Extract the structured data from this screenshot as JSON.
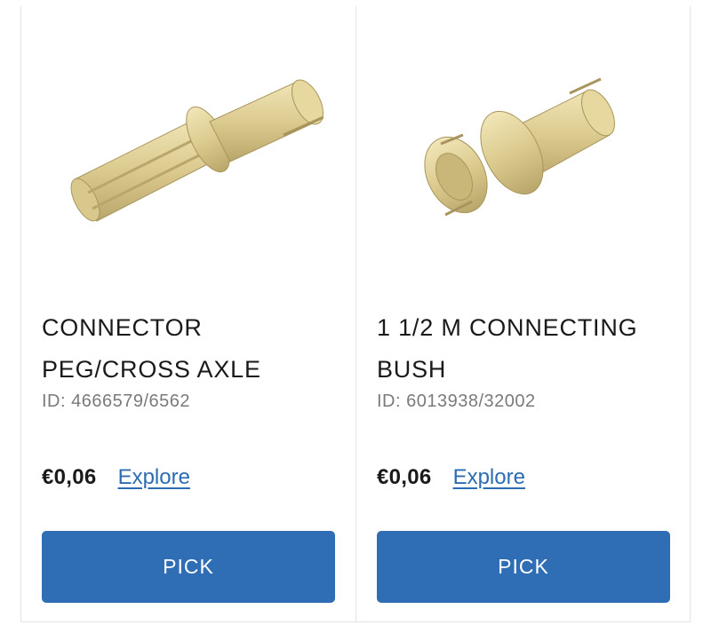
{
  "products": [
    {
      "title_line1": "CONNECTOR",
      "title_line2": "PEG/CROSS AXLE",
      "id_text": "ID: 4666579/6562",
      "price": "€0,06",
      "explore_label": "Explore",
      "pick_label": "PICK",
      "image": "connector-peg-cross-axle-image"
    },
    {
      "title_line1": "1 1/2 M CONNECTING",
      "title_line2": "BUSH",
      "id_text": "ID: 6013938/32002",
      "price": "€0,06",
      "explore_label": "Explore",
      "pick_label": "PICK",
      "image": "connecting-bush-image"
    }
  ],
  "colors": {
    "brick_tan": "#dccb8f",
    "button_blue": "#2f6db5",
    "link_blue": "#2c6cb3"
  }
}
